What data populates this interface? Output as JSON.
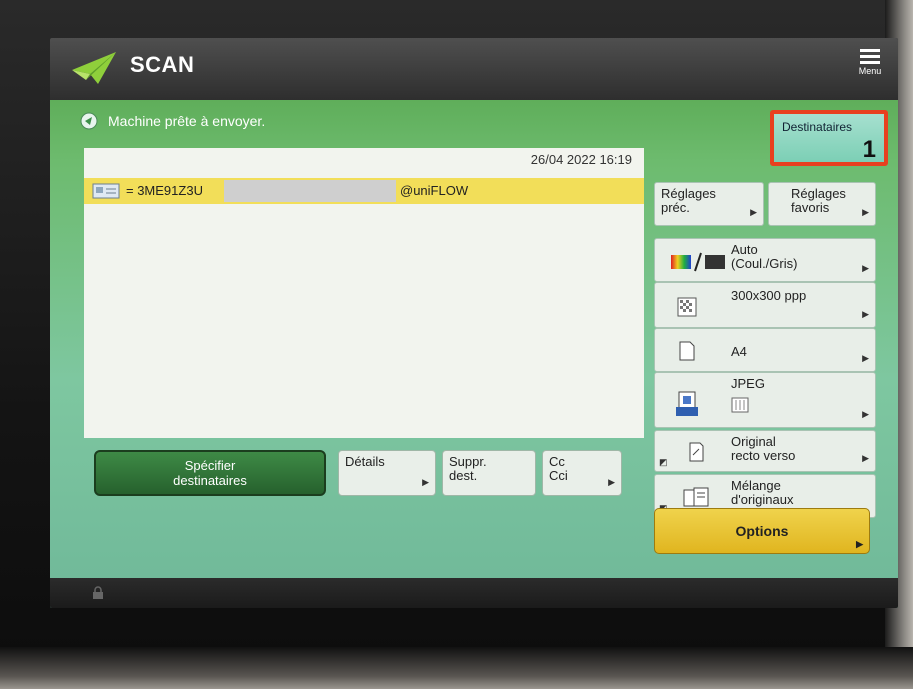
{
  "header": {
    "app_title": "SCAN",
    "menu_label": "Menu"
  },
  "status": {
    "text": "Machine prête à envoyer."
  },
  "destinations_box": {
    "label": "Destinataires",
    "count": "1"
  },
  "list": {
    "datetime": "26/04 2022 16:19",
    "rows": [
      {
        "prefix": "= 3ME91Z3U",
        "suffix": "@uniFLOW"
      }
    ]
  },
  "bottom_buttons": {
    "specify": {
      "line1": "Spécifier",
      "line2": "destinataires"
    },
    "details": "Détails",
    "remove": {
      "line1": "Suppr.",
      "line2": "dest."
    },
    "cc": {
      "line1": "Cc",
      "line2": "Cci"
    }
  },
  "top_right_buttons": {
    "previous": {
      "line1": "Réglages",
      "line2": "préc."
    },
    "favorites": {
      "line1": "Réglages",
      "line2": "favoris"
    }
  },
  "settings": {
    "color": {
      "line1": "Auto",
      "line2": "(Coul./Gris)"
    },
    "resolution": "300x300 ppp",
    "paper": "A4",
    "format": "JPEG",
    "original": {
      "line1": "Original",
      "line2": "recto verso"
    },
    "mixed": {
      "line1": "Mélange",
      "line2": "d'originaux"
    }
  },
  "options_label": "Options",
  "icons": [
    "app-plane-icon",
    "menu-icon",
    "status-icon",
    "contact-card-icon",
    "color-mode-icon",
    "resolution-icon",
    "paper-icon",
    "jpeg-icon",
    "original-icon",
    "mixed-originals-icon",
    "lock-icon"
  ],
  "colors": {
    "accent_green": "#2f7a35",
    "highlight_yellow": "#f2de59",
    "options_yellow": "#e8c43a",
    "highlight_red": "#e8401f"
  }
}
